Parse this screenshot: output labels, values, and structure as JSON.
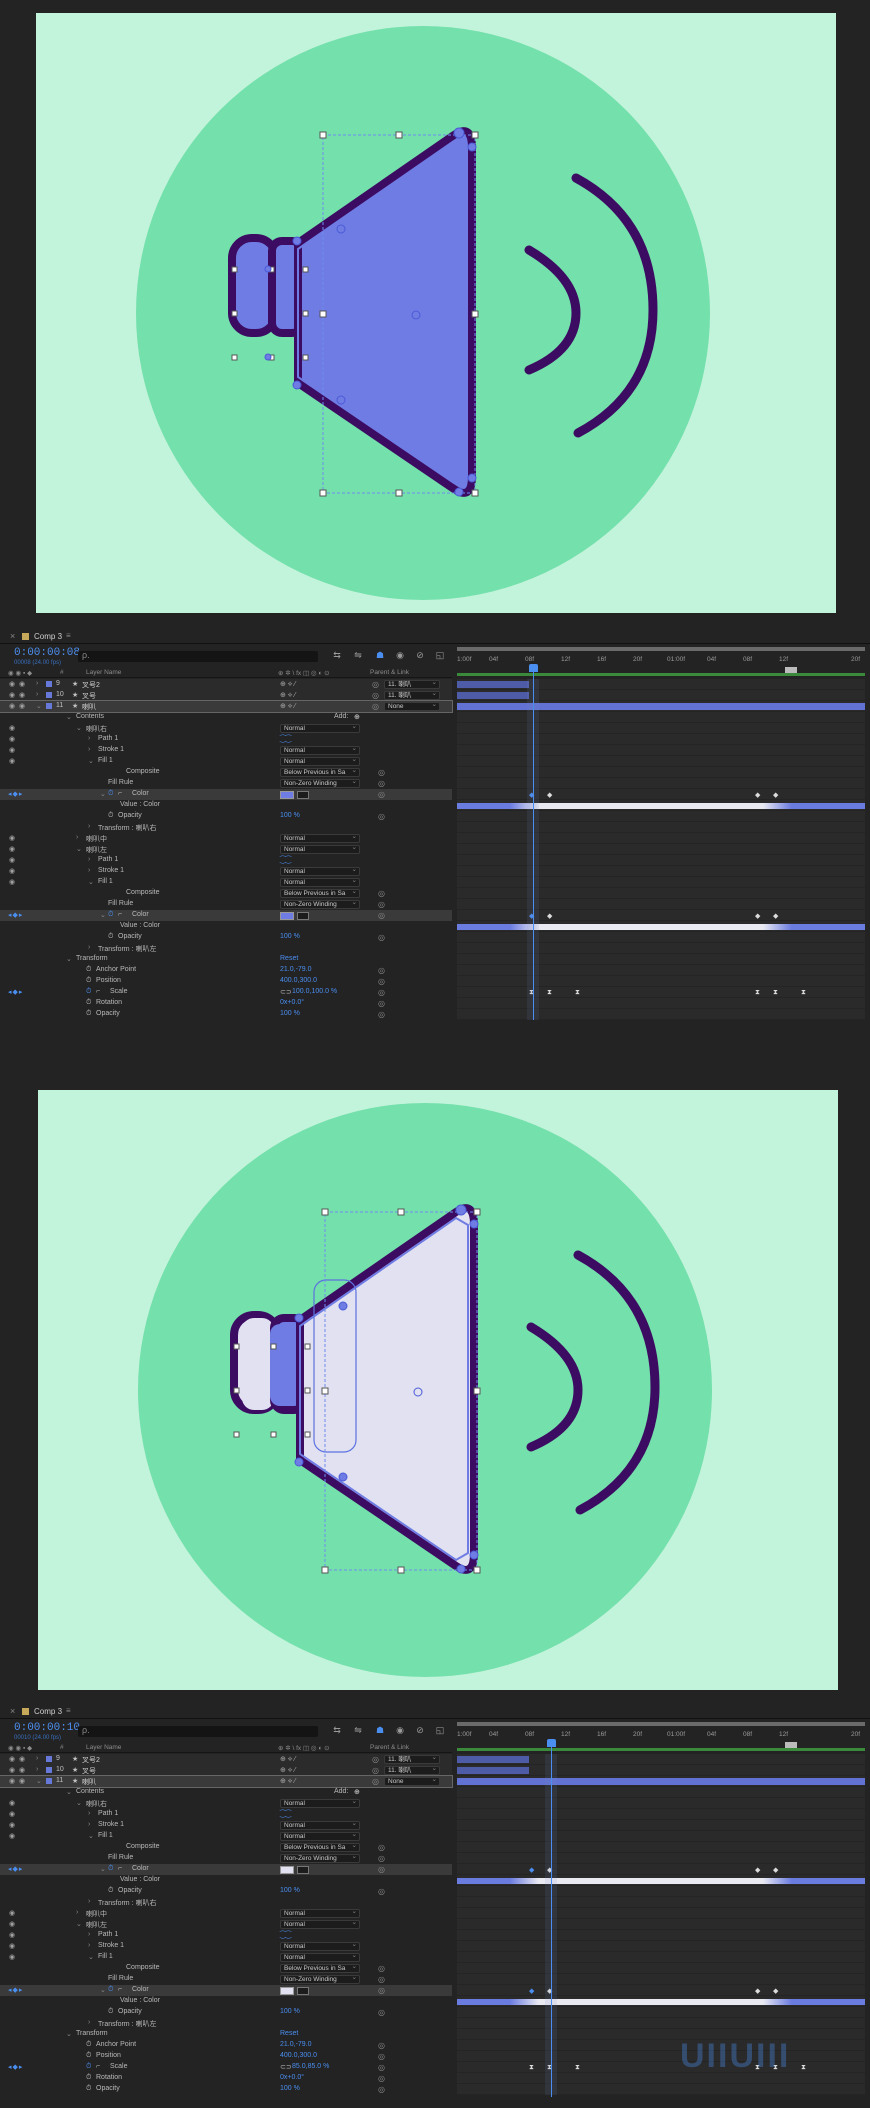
{
  "colors": {
    "bg_light": "#c2f4dc",
    "circle": "#74e0ab",
    "dark_purple": "#3c0c63",
    "blue_fill": "#6f7ce3",
    "pale_fill": "#e1e1f1",
    "label_blue": "#6678d8",
    "accent": "#4a8ef0"
  },
  "timeline_1": {
    "tab": {
      "close": "×",
      "label": "Comp 3",
      "menu": "≡"
    },
    "timecode": "0:00:00:08",
    "fps": "00008 (24.00 fps)",
    "search_icon": "ρ.",
    "toolbar": [
      "⇆",
      "⇋",
      "☗",
      "◉",
      "⊘",
      "◱"
    ],
    "columns": {
      "source": "Layer Name",
      "switches": "⊕ ✲ \\ fx ◫ ◎ ◐ ⊙",
      "parent": "Parent & Link"
    },
    "ruler_ticks": [
      "1:00f",
      "04f",
      "08f",
      "12f",
      "16f",
      "20f",
      "01:00f",
      "04f",
      "08f",
      "12f",
      "20f"
    ],
    "layers": [
      {
        "num": "9",
        "name": "叉号2",
        "parent": "11. 喇叭"
      },
      {
        "num": "10",
        "name": "叉号",
        "parent": "11. 喇叭"
      },
      {
        "num": "11",
        "name": "喇叭",
        "parent": "None"
      }
    ],
    "rows": {
      "contents": "Contents",
      "add": "Add:",
      "group_right": "喇叭右",
      "path1": "Path 1",
      "stroke1": "Stroke 1",
      "fill1": "Fill 1",
      "composite": "Composite",
      "fill_rule": "Fill Rule",
      "color": "Color",
      "value_color": "Value : Color",
      "opacity": "Opacity",
      "transform_right": "Transform : 喇叭右",
      "group_mid": "喇叭中",
      "group_left": "喇叭左",
      "transform_left": "Transform : 喇叭左",
      "transform": "Transform",
      "reset": "Reset",
      "anchor_point": "Anchor Point",
      "position": "Position",
      "scale": "Scale",
      "rotation": "Rotation",
      "opacity2": "Opacity"
    },
    "values": {
      "normal": "Normal",
      "composite": "Below Previous in Sa",
      "fill_rule": "Non-Zero Winding",
      "opacity": "100 %",
      "anchor": "21.0,-79.0",
      "position": "400.0,300.0",
      "scale": "100.0,100.0 %",
      "rotation": "0x+0.0°",
      "opacity2": "100 %"
    },
    "swatch_color": "#6f7ce3"
  },
  "timeline_2": {
    "timecode": "0:00:00:10",
    "fps": "00010 (24.00 fps)",
    "scale": "85.0,85.0 %",
    "swatch_color": "#e1e1f1"
  },
  "watermark": "UIIUIII"
}
